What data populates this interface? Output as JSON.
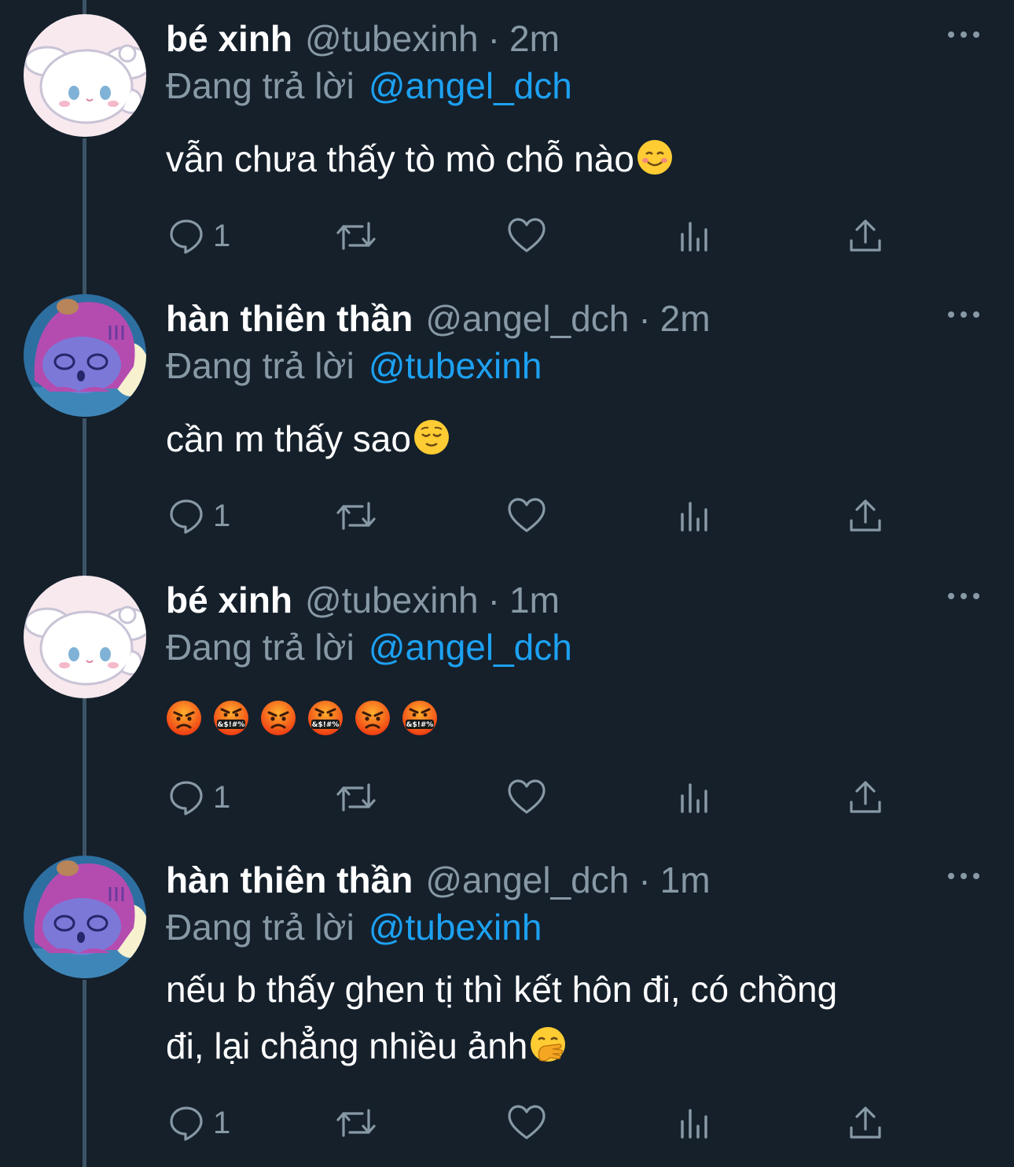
{
  "colors": {
    "background": "#15202b",
    "secondary_text": "#8899a6",
    "mention": "#1da1f2",
    "thread_line": "#3d5466"
  },
  "icons": {
    "reply": "comment-bubble-icon",
    "retweet": "retweet-arrows-icon",
    "like": "heart-outline-icon",
    "views": "bar-chart-icon",
    "share": "share-upload-icon",
    "more": "more-dots-icon"
  },
  "tweets": [
    {
      "name": "bé xinh",
      "handle": "@tubexinh",
      "separator": "·",
      "time": "2m",
      "reply_label": "Đang trả lời",
      "reply_to": "@angel_dch",
      "text": "vẫn chưa thấy tò mò chỗ nào",
      "emoji": "smiling-face-icon",
      "reply_count": "1"
    },
    {
      "name": "hàn thiên thần",
      "handle": "@angel_dch",
      "separator": "·",
      "time": "2m",
      "reply_label": "Đang trả lời",
      "reply_to": "@tubexinh",
      "text": "cần m thấy sao",
      "emoji": "relieved-face-icon",
      "reply_count": "1"
    },
    {
      "name": "bé xinh",
      "handle": "@tubexinh",
      "separator": "·",
      "time": "1m",
      "reply_label": "Đang trả lời",
      "reply_to": "@angel_dch",
      "emojis": [
        "angry-face-icon",
        "cursing-face-icon",
        "angry-face-icon",
        "cursing-face-icon",
        "angry-face-icon",
        "cursing-face-icon"
      ],
      "reply_count": "1"
    },
    {
      "name": "hàn thiên thần",
      "handle": "@angel_dch",
      "separator": "·",
      "time": "1m",
      "reply_label": "Đang trả lời",
      "reply_to": "@tubexinh",
      "text_line1": "nếu b thấy ghen tị thì kết hôn đi, có chồng",
      "text_line2": "đi, lại chẳng nhiều ảnh",
      "emoji": "hand-over-mouth-face-icon",
      "reply_count": "1"
    }
  ]
}
